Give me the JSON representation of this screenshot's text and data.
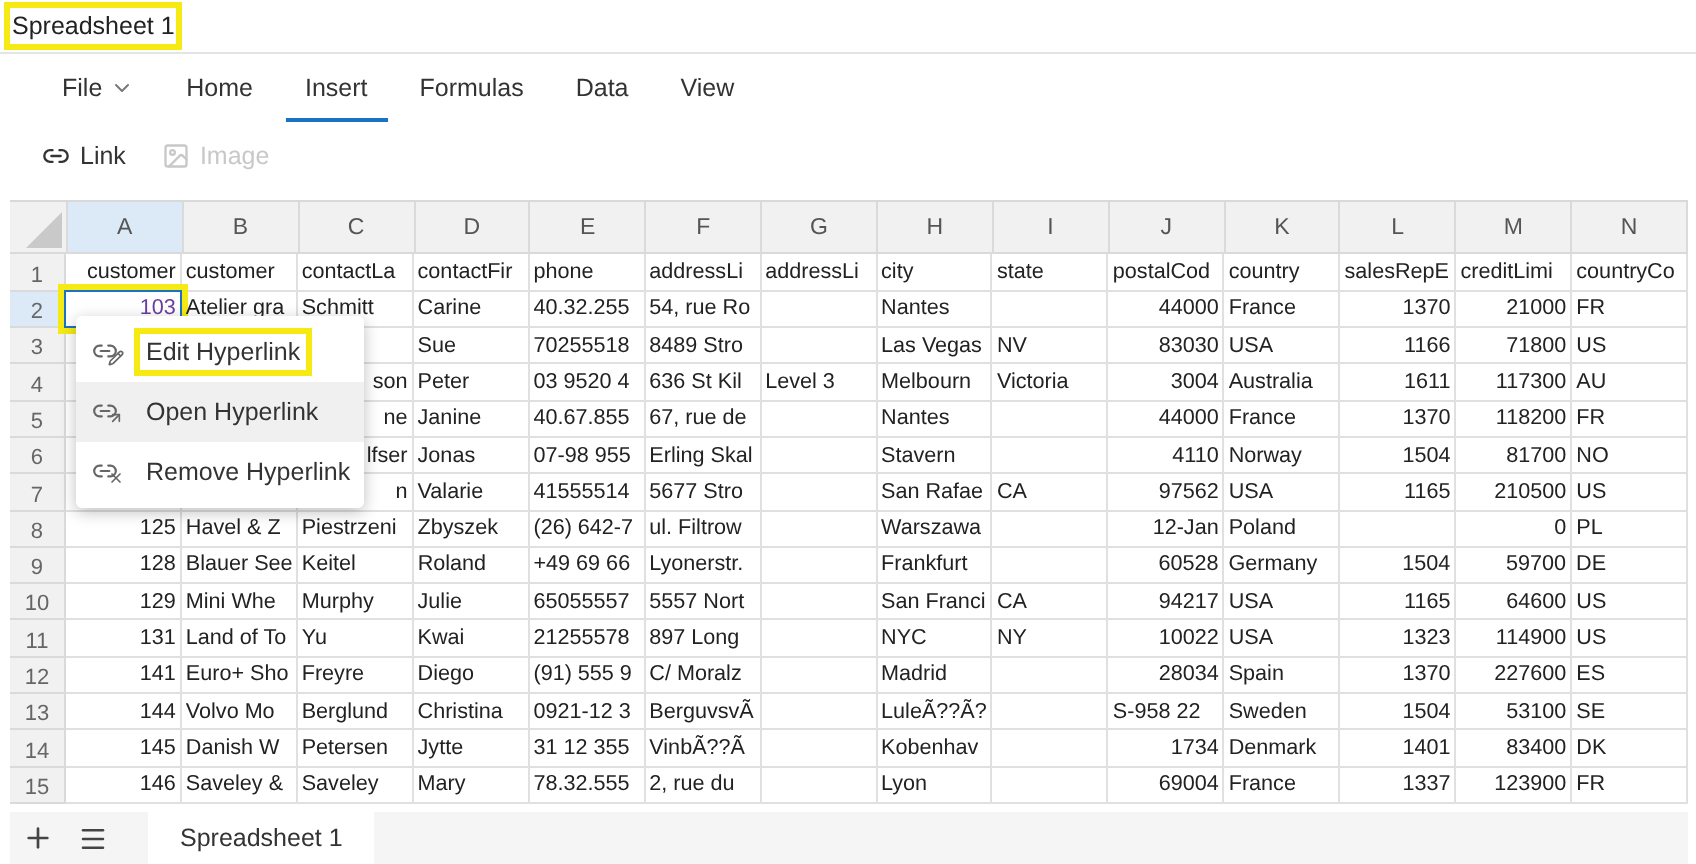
{
  "window": {
    "title": "Spreadsheet 1",
    "highlighted": true
  },
  "ribbon_tabs": [
    {
      "label": "File",
      "kind": "menu",
      "selected": false
    },
    {
      "label": "Home",
      "kind": "tab",
      "selected": false
    },
    {
      "label": "Insert",
      "kind": "tab",
      "selected": true
    },
    {
      "label": "Formulas",
      "kind": "tab",
      "selected": false
    },
    {
      "label": "Data",
      "kind": "tab",
      "selected": false
    },
    {
      "label": "View",
      "kind": "tab",
      "selected": false
    }
  ],
  "toolbar": [
    {
      "label": "Link",
      "kind": "link",
      "disabled": false
    },
    {
      "label": "Image",
      "kind": "image",
      "disabled": true
    }
  ],
  "grid": {
    "columns": [
      {
        "letter": "A",
        "selected": true
      },
      {
        "letter": "B",
        "selected": false
      },
      {
        "letter": "C",
        "selected": false
      },
      {
        "letter": "D",
        "selected": false
      },
      {
        "letter": "E",
        "selected": false
      },
      {
        "letter": "F",
        "selected": false
      },
      {
        "letter": "G",
        "selected": false
      },
      {
        "letter": "H",
        "selected": false
      },
      {
        "letter": "I",
        "selected": false
      },
      {
        "letter": "J",
        "selected": false
      },
      {
        "letter": "K",
        "selected": false
      },
      {
        "letter": "L",
        "selected": false
      },
      {
        "letter": "M",
        "selected": false
      },
      {
        "letter": "N",
        "selected": false
      }
    ],
    "rows": [
      {
        "number": "1",
        "selected": false,
        "cells": [
          "customer",
          "customer",
          "contactLa",
          "contactFir",
          "phone",
          "addressLi",
          "addressLi",
          "city",
          "state",
          {
            "text": "postalCod",
            "kind": "text"
          },
          "country",
          {
            "text": "salesRepE",
            "kind": "text"
          },
          {
            "text": "creditLimi",
            "kind": "text"
          },
          "countryCo"
        ]
      },
      {
        "number": "2",
        "selected": true,
        "cells": [
          {
            "text": "103",
            "kind": "link",
            "selected": true,
            "highlighted": true
          },
          "Atelier gra",
          "Schmitt",
          "Carine",
          "40.32.255",
          "54, rue Ro",
          null,
          "Nantes",
          null,
          "44000",
          "France",
          "1370",
          "21000",
          "FR"
        ]
      },
      {
        "number": "3",
        "selected": false,
        "cells": [
          {
            "kind": "covered"
          },
          {
            "kind": "covered"
          },
          null,
          "Sue",
          "70255518",
          "8489 Stro",
          null,
          "Las Vegas",
          "NV",
          "83030",
          "USA",
          "1166",
          "71800",
          "US"
        ]
      },
      {
        "number": "4",
        "selected": false,
        "cells": [
          {
            "kind": "covered"
          },
          {
            "kind": "covered"
          },
          {
            "text": "son",
            "kind": "partial"
          },
          "Peter",
          "03 9520 4",
          "636 St Kil",
          "Level 3",
          "Melbourn",
          "Victoria",
          "3004",
          "Australia",
          "1611",
          "117300",
          "AU"
        ]
      },
      {
        "number": "5",
        "selected": false,
        "cells": [
          {
            "kind": "covered"
          },
          {
            "kind": "covered"
          },
          {
            "text": "ne",
            "kind": "partial"
          },
          "Janine",
          "40.67.855",
          "67, rue de",
          null,
          "Nantes",
          null,
          "44000",
          "France",
          "1370",
          "118200",
          "FR"
        ]
      },
      {
        "number": "6",
        "selected": false,
        "cells": [
          {
            "kind": "covered"
          },
          {
            "kind": "covered"
          },
          {
            "text": "lfser",
            "kind": "partial"
          },
          "Jonas",
          "07-98 955",
          "Erling Skal",
          null,
          "Stavern",
          null,
          "4110",
          "Norway",
          "1504",
          "81700",
          "NO"
        ]
      },
      {
        "number": "7",
        "selected": false,
        "cells": [
          {
            "kind": "covered"
          },
          {
            "kind": "covered"
          },
          {
            "text": "n",
            "kind": "partial"
          },
          "Valarie",
          "41555514",
          "5677 Stro",
          null,
          "San Rafae",
          "CA",
          "97562",
          "USA",
          "1165",
          "210500",
          "US"
        ]
      },
      {
        "number": "8",
        "selected": false,
        "cells": [
          "125",
          "Havel & Z",
          "Piestrzeni",
          "Zbyszek",
          "(26) 642-7",
          "ul. Filtrow",
          null,
          "Warszawa",
          null,
          "12-Jan",
          "Poland",
          null,
          "0",
          "PL"
        ]
      },
      {
        "number": "9",
        "selected": false,
        "cells": [
          "128",
          "Blauer See",
          "Keitel",
          "Roland",
          "+49 69 66",
          "Lyonerstr.",
          null,
          "Frankfurt",
          null,
          "60528",
          "Germany",
          "1504",
          "59700",
          "DE"
        ]
      },
      {
        "number": "10",
        "selected": false,
        "cells": [
          "129",
          "Mini Whe",
          "Murphy",
          "Julie",
          "65055557",
          "5557 Nort",
          null,
          "San Franci",
          "CA",
          "94217",
          "USA",
          "1165",
          "64600",
          "US"
        ]
      },
      {
        "number": "11",
        "selected": false,
        "cells": [
          "131",
          "Land of To",
          "Yu",
          "Kwai",
          "21255578",
          "897 Long",
          null,
          "NYC",
          "NY",
          "10022",
          "USA",
          "1323",
          "114900",
          "US"
        ]
      },
      {
        "number": "12",
        "selected": false,
        "cells": [
          "141",
          "Euro+ Sho",
          "Freyre",
          "Diego",
          "(91) 555 9",
          "C/ Moralz",
          null,
          "Madrid",
          null,
          "28034",
          "Spain",
          "1370",
          "227600",
          "ES"
        ]
      },
      {
        "number": "13",
        "selected": false,
        "cells": [
          "144",
          "Volvo Mo",
          "Berglund",
          "Christina",
          "0921-12 3",
          "BerguvsvÃ",
          null,
          "LuleÃ??Ã?",
          null,
          {
            "text": "S-958 22",
            "kind": "text"
          },
          "Sweden",
          "1504",
          "53100",
          "SE"
        ]
      },
      {
        "number": "14",
        "selected": false,
        "cells": [
          "145",
          "Danish W",
          "Petersen",
          "Jytte",
          "31 12 355",
          "VinbÃ??Ã",
          null,
          "Kobenhav",
          null,
          "1734",
          "Denmark",
          "1401",
          "83400",
          "DK"
        ]
      },
      {
        "number": "15",
        "selected": false,
        "cells": [
          "146",
          "Saveley &",
          "Saveley",
          "Mary",
          "78.32.555",
          "2, rue du",
          null,
          "Lyon",
          null,
          "69004",
          "France",
          "1337",
          "123900",
          "FR"
        ]
      }
    ]
  },
  "context_menu": [
    {
      "label": "Edit Hyperlink",
      "kind": "edit",
      "highlighted": true,
      "hovered": false
    },
    {
      "label": "Open Hyperlink",
      "kind": "open",
      "highlighted": false,
      "hovered": true
    },
    {
      "label": "Remove Hyperlink",
      "kind": "remove",
      "highlighted": false,
      "hovered": false
    }
  ],
  "sheet_tabs": [
    {
      "label": "Spreadsheet 1",
      "selected": true
    }
  ]
}
